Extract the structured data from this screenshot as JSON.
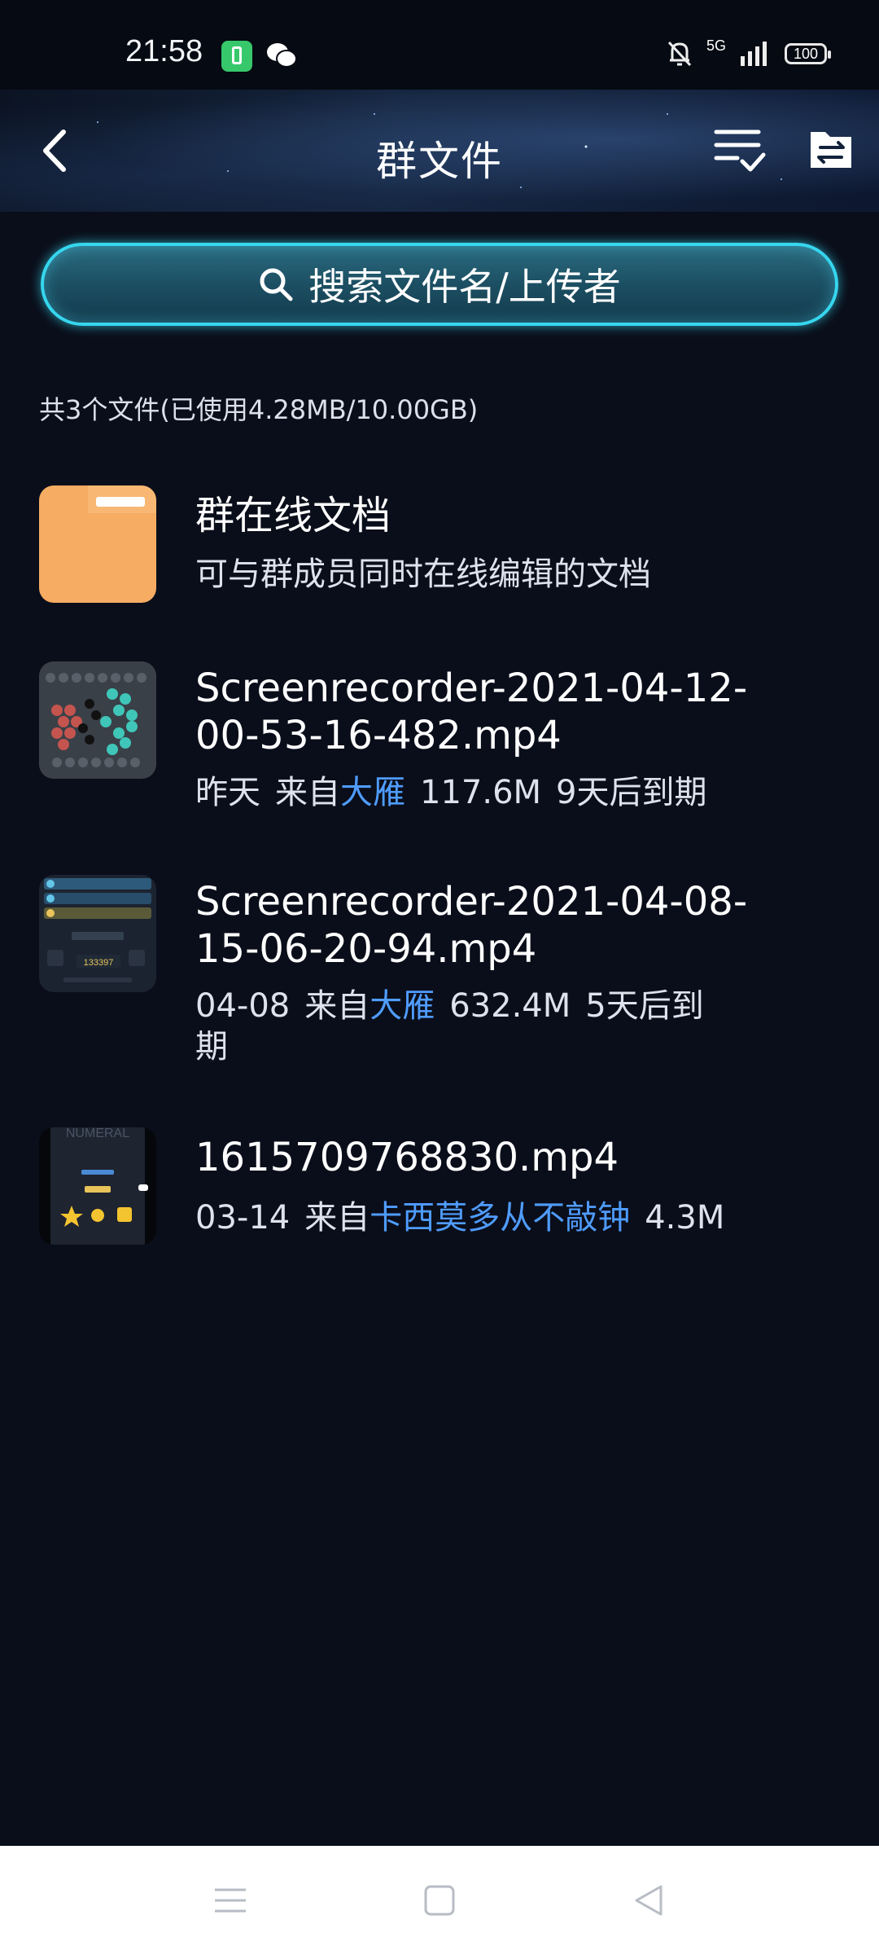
{
  "status_bar": {
    "time": "21:58",
    "network": "5G",
    "battery": "100",
    "icons": [
      "battery-charge-icon",
      "wechat-icon",
      "mute-bell-icon",
      "signal-icon"
    ]
  },
  "header": {
    "title": "群文件",
    "icons": [
      "back-arrow-icon",
      "sort-check-icon",
      "file-transfer-icon"
    ]
  },
  "search": {
    "placeholder": "搜索文件名/上传者",
    "icon": "search-icon"
  },
  "summary": "共3个文件(已使用4.28MB/10.00GB)",
  "items": [
    {
      "name": "群在线文档",
      "subtitle": "可与群成员同时在线编辑的文档",
      "icon": "folder-icon"
    },
    {
      "name": "Screenrecorder-2021-04-12-00-53-16-482.mp4",
      "date": "昨天",
      "from_prefix": "来自",
      "uploader": "大雁",
      "size": "117.6M",
      "expiry": "9天后到期"
    },
    {
      "name": "Screenrecorder-2021-04-08-15-06-20-94.mp4",
      "date": "04-08",
      "from_prefix": "来自",
      "uploader": "大雁",
      "size": "632.4M",
      "expiry": "5天后到期"
    },
    {
      "name": "1615709768830.mp4",
      "date": "03-14",
      "from_prefix": "来自",
      "uploader": "卡西莫多从不敲钟",
      "size": "4.3M"
    }
  ],
  "colors": {
    "background": "#0a0e1a",
    "accent_link": "#4f9cff",
    "search_border": "#36d6ee",
    "folder": "#f6ac63"
  },
  "navbar": {
    "icons": [
      "menu-icon",
      "home-square-icon",
      "back-triangle-icon"
    ]
  }
}
